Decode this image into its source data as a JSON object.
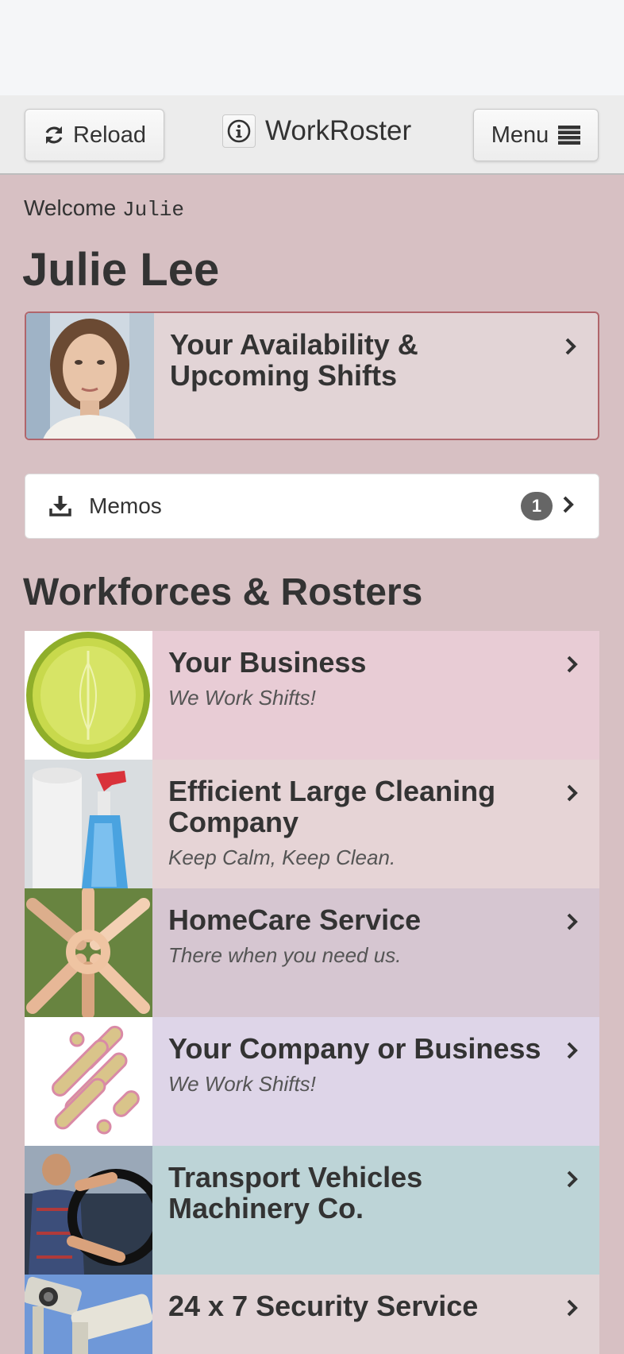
{
  "header": {
    "reload_label": "Reload",
    "app_title": "WorkRoster",
    "menu_label": "Menu"
  },
  "welcome": {
    "prefix": "Welcome",
    "username": "Julie"
  },
  "user": {
    "full_name": "Julie Lee"
  },
  "availability": {
    "title": "Your Availability & Upcoming Shifts"
  },
  "memos": {
    "label": "Memos",
    "count": "1"
  },
  "section_title": "Workforces & Rosters",
  "workforces": [
    {
      "title": "Your Business",
      "subtitle": "We Work Shifts!",
      "bg": "#e8ccd5"
    },
    {
      "title": "Efficient Large Cleaning Company",
      "subtitle": "Keep Calm, Keep Clean.",
      "bg": "#e6d4d6"
    },
    {
      "title": "HomeCare Service",
      "subtitle": "There when you need us.",
      "bg": "#d6c6d1"
    },
    {
      "title": "Your Company or Business",
      "subtitle": "We Work Shifts!",
      "bg": "#ded5e8"
    },
    {
      "title": "Transport Vehicles Machinery Co.",
      "subtitle": "",
      "bg": "#bdd4d7"
    },
    {
      "title": "24 x 7 Security Service",
      "subtitle": "",
      "bg": "#e2d4d6"
    }
  ]
}
